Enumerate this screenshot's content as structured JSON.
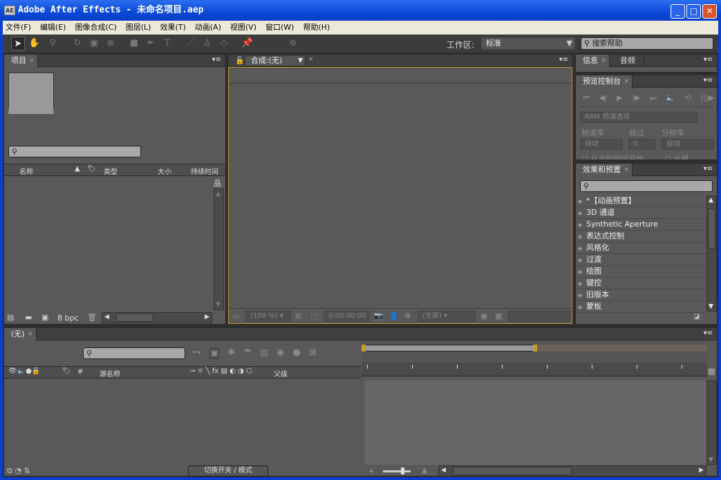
{
  "window": {
    "title": "Adobe After Effects - 未命名项目.aep",
    "app_icon": "AE",
    "minimize": "_",
    "maximize": "□",
    "close": "✕"
  },
  "menu": [
    "文件(F)",
    "编辑(E)",
    "图像合成(C)",
    "图层(L)",
    "效果(T)",
    "动画(A)",
    "视图(V)",
    "窗口(W)",
    "帮助(H)"
  ],
  "toolbar": {
    "tools": [
      "selection-tool",
      "hand-tool",
      "zoom-tool",
      "rotate-tool",
      "camera-tool",
      "pan-behind-tool",
      "rectangle-tool",
      "pen-tool",
      "text-tool",
      "brush-tool",
      "clone-stamp-tool",
      "eraser-tool",
      "puppet-pin-tool"
    ],
    "workspace_label": "工作区:",
    "workspace_value": "标准",
    "search_help": "搜索帮助"
  },
  "project": {
    "tab": "项目",
    "columns": [
      "名称",
      "类型",
      "大小",
      "持续时间"
    ],
    "bpc": "8 bpc"
  },
  "composition": {
    "tab": "合成:(无)",
    "zoom": "(100 %)",
    "timecode": "0:00:00:00",
    "resolution": "(全屏)"
  },
  "info": {
    "tabs": [
      "信息",
      "音频"
    ]
  },
  "preview": {
    "tab": "预览控制台",
    "ram_options": "RAM 预演选项",
    "frame_rate_label": "帧速率",
    "skip_label": "跳过",
    "resolution_label": "分辨率",
    "frame_rate": "自动",
    "skip": "0",
    "resolution": "自动",
    "from_current": "从当前时间开始",
    "fullscreen": "全屏"
  },
  "effects": {
    "tab": "效果和预置",
    "items": [
      "*【动画预置】",
      "3D 通道",
      "Synthetic Aperture",
      "表达式控制",
      "风格化",
      "过渡",
      "绘图",
      "键控",
      "旧版本",
      "蒙板"
    ]
  },
  "timeline": {
    "tab": "(无)",
    "columns": {
      "hash": "#",
      "source_name": "源名称",
      "parent": "父级"
    },
    "toggle_button": "切换开关 / 模式"
  },
  "colors": {
    "accent": "#c89a28",
    "panel": "#595959",
    "titlebar": "#0a48d8"
  }
}
